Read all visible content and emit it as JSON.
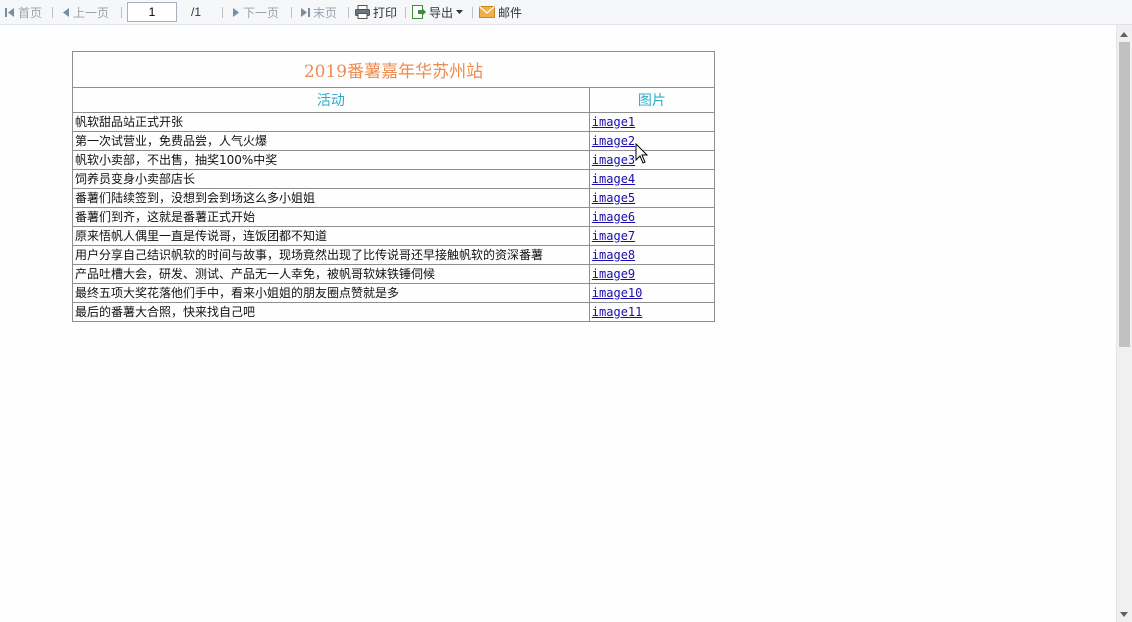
{
  "toolbar": {
    "first_label": "首页",
    "prev_label": "上一页",
    "page_value": "1",
    "page_total": "/1",
    "next_label": "下一页",
    "last_label": "末页",
    "print_label": "打印",
    "export_label": "导出",
    "mail_label": "邮件"
  },
  "report": {
    "title": "2019番薯嘉年华苏州站",
    "headers": {
      "activity": "活动",
      "image": "图片"
    },
    "rows": [
      {
        "activity": "帆软甜品站正式开张",
        "image": "image1"
      },
      {
        "activity": "第一次试营业，免费品尝，人气火爆",
        "image": "image2"
      },
      {
        "activity": "帆软小卖部，不出售，抽奖100%中奖",
        "image": "image3"
      },
      {
        "activity": "饲养员变身小卖部店长",
        "image": "image4"
      },
      {
        "activity": "番薯们陆续签到，没想到会到场这么多小姐姐",
        "image": "image5"
      },
      {
        "activity": "番薯们到齐，这就是番薯正式开始",
        "image": "image6"
      },
      {
        "activity": "原来悟帆人偶里一直是传说哥，连饭团都不知道",
        "image": "image7"
      },
      {
        "activity": "用户分享自己结识帆软的时间与故事，现场竟然出现了比传说哥还早接触帆软的资深番薯",
        "image": "image8"
      },
      {
        "activity": "产品吐槽大会，研发、测试、产品无一人幸免，被帆哥软妹铁锤伺候",
        "image": "image9"
      },
      {
        "activity": "最终五项大奖花落他们手中，看来小姐姐的朋友圈点赞就是多",
        "image": "image10"
      },
      {
        "activity": "最后的番薯大合照，快来找自己吧",
        "image": "image11"
      }
    ]
  },
  "colors": {
    "title": "#ef8c4f",
    "header": "#2aaecb",
    "link": "#1a0dab",
    "toolbar_bg": "#f6f7f9"
  },
  "icons": {
    "first": "first-page-icon",
    "prev": "prev-page-icon",
    "next": "next-page-icon",
    "last": "last-page-icon",
    "print": "printer-icon",
    "export": "export-icon",
    "mail": "mail-icon"
  }
}
